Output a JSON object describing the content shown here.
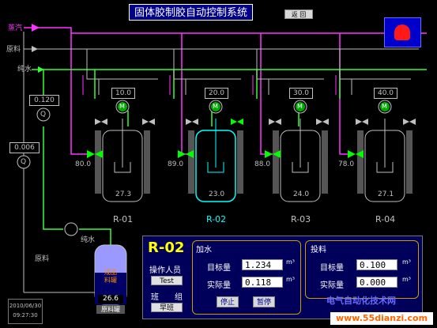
{
  "title": "固体胶制胶自动控制系统",
  "back_button": "返 回",
  "lines": {
    "steam": "蒸汽",
    "material": "原料",
    "pure_water": "纯水"
  },
  "flow_meters": {
    "water_value": "0.120",
    "material_value": "0.006",
    "meter_symbol": "Q",
    "motor_symbol": "M"
  },
  "reactors": [
    {
      "setpoint": "10.0",
      "valve_temp": "80.0",
      "vessel_temp": "27.3",
      "name": "R-01",
      "active": false
    },
    {
      "setpoint": "20.0",
      "valve_temp": "89.0",
      "vessel_temp": "23.0",
      "name": "R-02",
      "active": true
    },
    {
      "setpoint": "30.0",
      "valve_temp": "88.0",
      "vessel_temp": "24.0",
      "name": "R-03",
      "active": false
    },
    {
      "setpoint": "40.0",
      "valve_temp": "78.0",
      "vessel_temp": "27.1",
      "name": "R-04",
      "active": false
    }
  ],
  "pump": {
    "label": "纯水"
  },
  "tank": {
    "inlet_label": "原料",
    "text": "成品\n料罐",
    "value": "26.6",
    "name": "原料罐"
  },
  "datetime": {
    "date": "2010/06/30",
    "time": "09:27:30"
  },
  "panel": {
    "reactor": "R-02",
    "operator_label": "操作人员",
    "operator": "Test",
    "shift_label1": "班",
    "shift_label2": "组",
    "shift": "早班",
    "water": {
      "section": "加水",
      "target_label": "目标量",
      "target": "1.234",
      "actual_label": "实际量",
      "actual": "0.118",
      "unit": "m³",
      "stop": "停止",
      "pause": "暂停"
    },
    "feed": {
      "section": "投料",
      "target_label": "目标量",
      "target": "0.100",
      "actual_label": "实际量",
      "actual": "0.000",
      "unit": "m³"
    }
  },
  "watermark": {
    "cn": "电气自动化技术网",
    "url": "www.55dianzi.com"
  },
  "colors": {
    "steam": "#ff33ff",
    "water": "#33ff33",
    "material": "#c0c0c0",
    "active_vessel": "#00ffff",
    "valve": "#00ff00",
    "accent_title": "#ffff00"
  }
}
